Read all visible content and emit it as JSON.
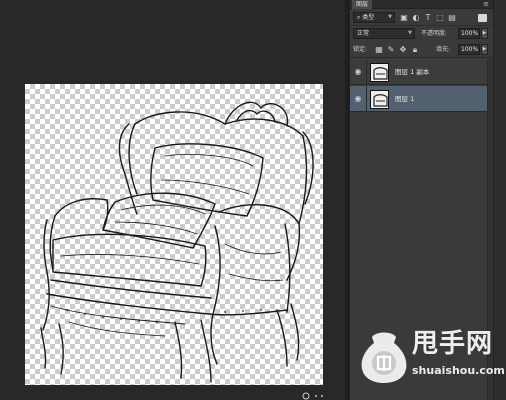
{
  "panel": {
    "tab_label": "图层",
    "menu_icon": "panel-menu-icon",
    "filter": {
      "kind_label": "类型",
      "icons": [
        "image-filter-icon",
        "adjustment-filter-icon",
        "text-filter-icon",
        "shape-filter-icon",
        "smart-object-filter-icon"
      ]
    },
    "blend_mode": "正常",
    "opacity_label": "不透明度:",
    "opacity_value": "100%",
    "lock_label": "锁定:",
    "fill_label": "填充:",
    "fill_value": "100%",
    "layers": [
      {
        "name": "图层 1 副本",
        "visible": true,
        "selected": false
      },
      {
        "name": "图层 1",
        "visible": true,
        "selected": true
      }
    ]
  },
  "watermark": {
    "site": "甩手网",
    "url": "shuaishou.com"
  },
  "colors": {
    "panel_bg": "#3a3a3a",
    "selected_layer": "#53606f",
    "app_bg": "#282828"
  }
}
